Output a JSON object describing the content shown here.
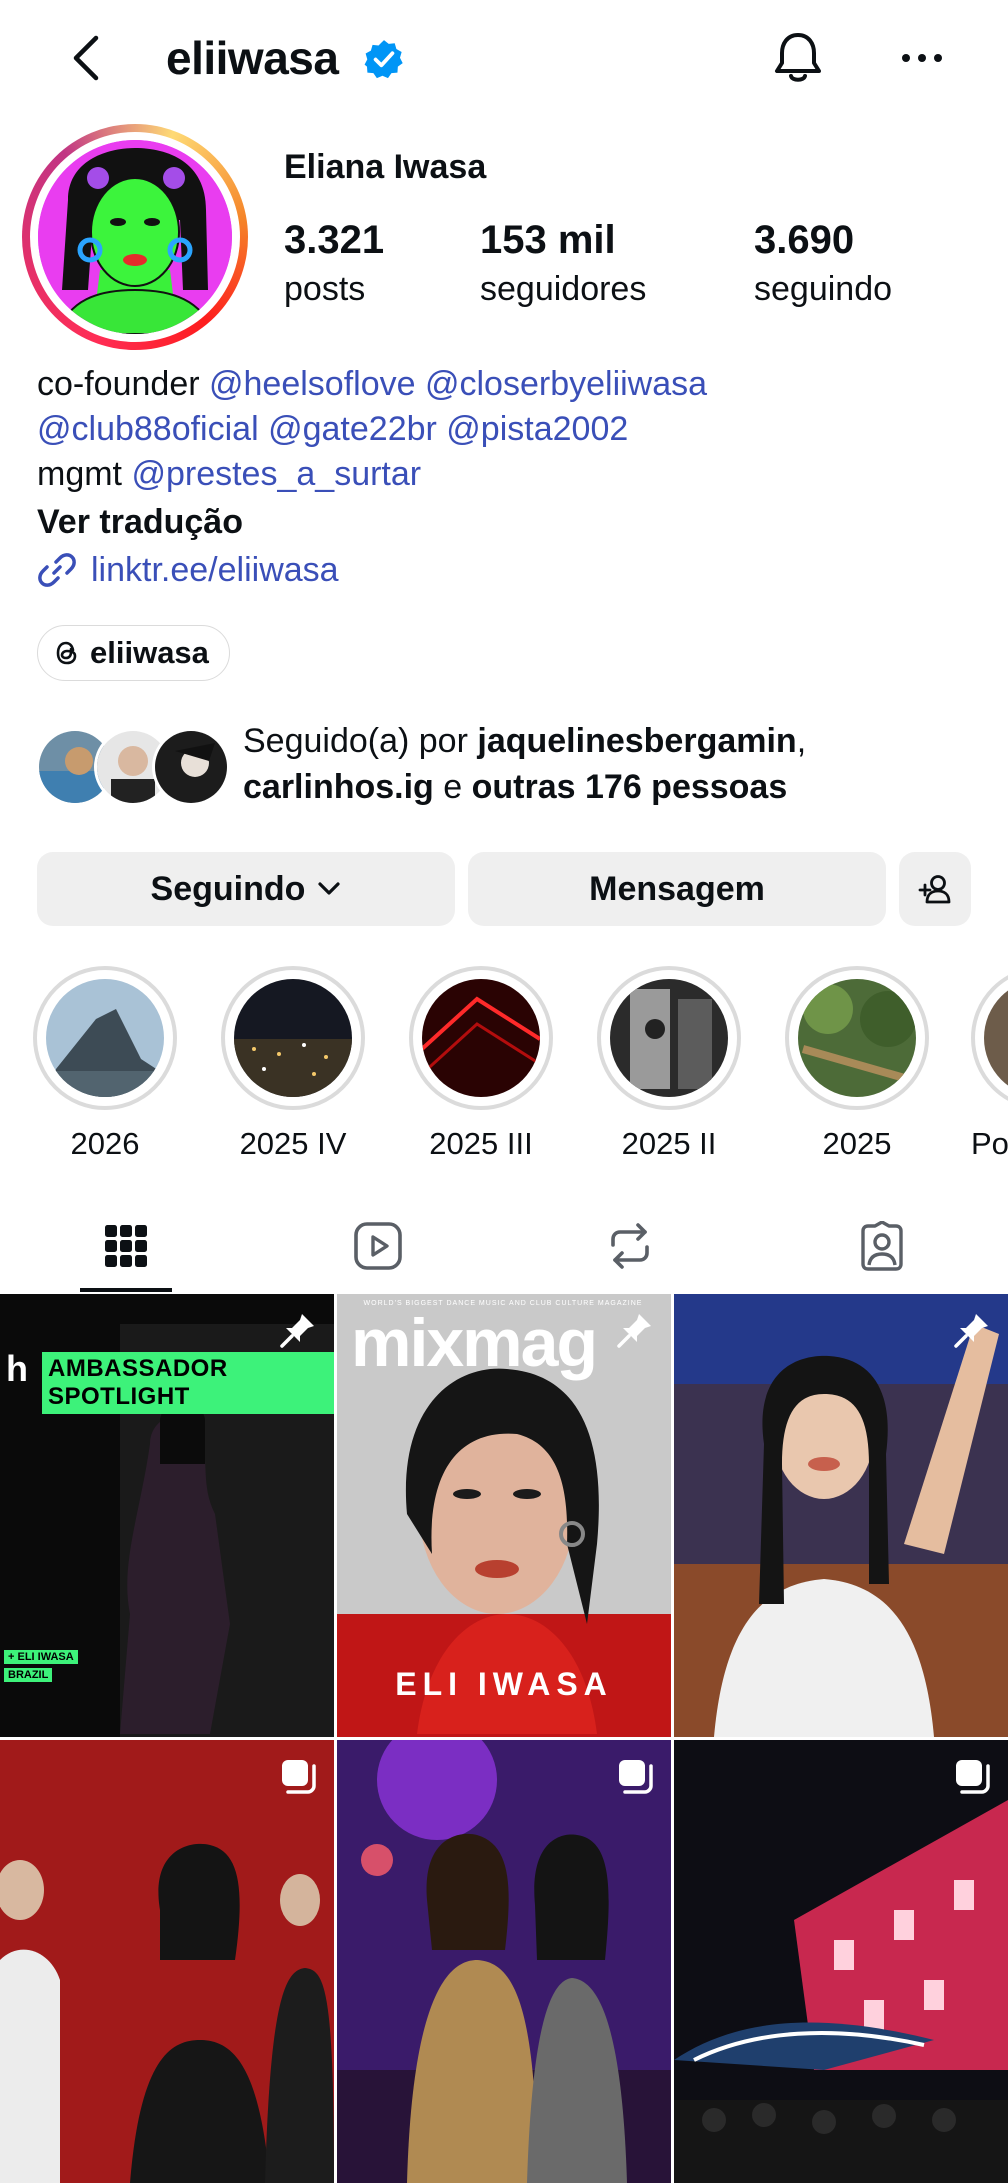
{
  "header": {
    "username": "eliiwasa",
    "verified": true
  },
  "profile": {
    "full_name": "Eliana Iwasa",
    "stats": [
      {
        "value": "3.321",
        "label": "posts"
      },
      {
        "value": "153 mil",
        "label": "seguidores"
      },
      {
        "value": "3.690",
        "label": "seguindo"
      }
    ],
    "bio": {
      "line1_prefix": "co-founder ",
      "line1_links": [
        "@heelsoflove",
        "@closerbyeliiwasa"
      ],
      "line2_links": [
        "@club88oficial",
        "@gate22br",
        "@pista2002"
      ],
      "line3_prefix": "mgmt ",
      "line3_link": "@prestes_a_surtar",
      "translate": "Ver tradução",
      "website": "linktr.ee/eliiwasa"
    },
    "threads_handle": "eliiwasa"
  },
  "followed_by": {
    "prefix": "Seguido(a) por ",
    "user1": "jaquelinesbergamin",
    "comma": ",",
    "user2": "carlinhos.ig",
    "connector": " e ",
    "others": "outras 176 pessoas"
  },
  "actions": {
    "following": "Seguindo",
    "message": "Mensagem"
  },
  "highlights": [
    {
      "label": "2026"
    },
    {
      "label": "2025 IV"
    },
    {
      "label": "2025 III"
    },
    {
      "label": "2025 II"
    },
    {
      "label": "2025"
    },
    {
      "label": "Por"
    }
  ],
  "tabs": [
    {
      "name": "grid-icon",
      "active": true
    },
    {
      "name": "reels-icon",
      "active": false
    },
    {
      "name": "reposts-icon",
      "active": false
    },
    {
      "name": "tagged-icon",
      "active": false
    }
  ],
  "posts": {
    "p1": {
      "banner": "AMBASSADOR SPOTLIGHT",
      "tag1": "+ ELI IWASA",
      "tag2": "BRAZIL",
      "pinned": true
    },
    "p2": {
      "masthead": "mixmag",
      "tagline": "WORLD'S BIGGEST DANCE MUSIC AND CLUB CULTURE MAGAZINE",
      "caption": "ELI IWASA",
      "pinned": true
    },
    "p3": {
      "pinned": true
    },
    "p4": {
      "carousel": true
    },
    "p5": {
      "carousel": true
    },
    "p6": {
      "carousel": true
    }
  },
  "colors": {
    "link": "#3a4fb8",
    "verified": "#0095f6",
    "button_bg": "#efefef"
  }
}
